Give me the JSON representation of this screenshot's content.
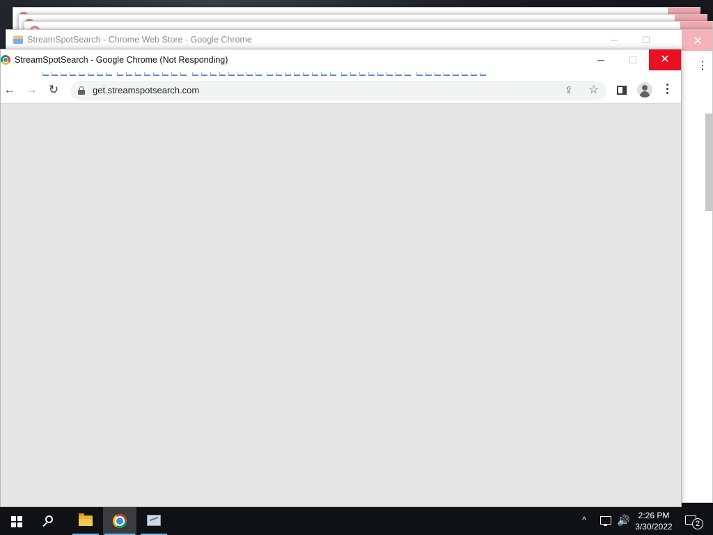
{
  "background_windows": {
    "store_window_title": "StreamSpotSearch - Chrome Web Store - Google Chrome"
  },
  "main_window": {
    "title": "StreamSpotSearch - Google Chrome (Not Responding)",
    "minimize_glyph": "─",
    "maximize_glyph": "☐",
    "close_glyph": "✕"
  },
  "toolbar": {
    "back_glyph": "←",
    "forward_glyph": "→",
    "reload_glyph": "↻",
    "url": "get.streamspotsearch.com",
    "share_glyph": "⇪",
    "star_glyph": "☆"
  },
  "taskbar": {
    "time": "2:26 PM",
    "date": "3/30/2022",
    "tray_chevron": "^",
    "volume_glyph": "🔊",
    "notification_count": "2"
  },
  "icons": {
    "start": "windows-logo-icon",
    "search": "search-icon",
    "explorer": "folder-icon",
    "chrome": "chrome-icon",
    "app": "picture-app-icon",
    "lock": "lock-icon",
    "profile": "profile-icon",
    "menu": "kebab-menu-icon",
    "sidepanel": "side-panel-icon"
  },
  "colors": {
    "close_red": "#e81123",
    "page_background": "#e6e6e6",
    "taskbar": "#101114",
    "taskbar_active_underline": "#76b9ed"
  }
}
